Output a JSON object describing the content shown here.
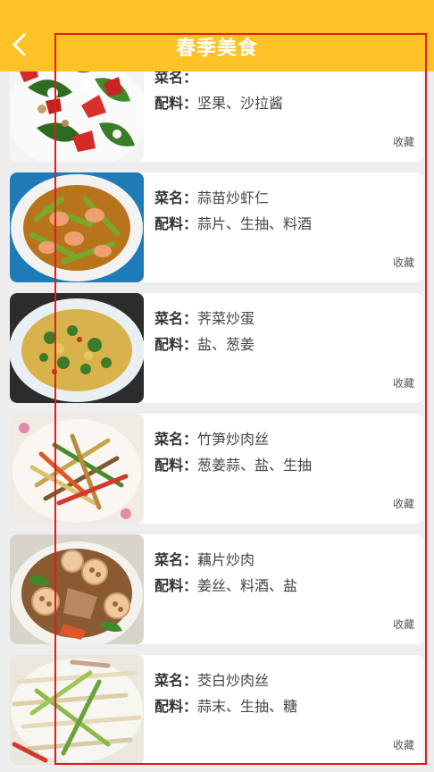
{
  "header": {
    "title": "春季美食",
    "back_icon": "chevron-left-icon",
    "background": "#fec126"
  },
  "labels": {
    "name_key": "菜名：",
    "ingredient_key": "配料：",
    "favorite": "收藏"
  },
  "items": [
    {
      "name": "",
      "ingredients": "坚果、沙拉酱",
      "image": "strawberry-spinach-salad"
    },
    {
      "name": "蒜苗炒虾仁",
      "ingredients": "蒜片、生抽、料酒",
      "image": "shrimp-garlic-sprouts"
    },
    {
      "name": "荠菜炒蛋",
      "ingredients": "盐、葱姜",
      "image": "shepherds-purse-egg"
    },
    {
      "name": "竹笋炒肉丝",
      "ingredients": "葱姜蒜、盐、生抽",
      "image": "bamboo-shoot-pork"
    },
    {
      "name": "藕片炒肉",
      "ingredients": "姜丝、料酒、盐",
      "image": "lotus-root-pork"
    },
    {
      "name": "茭白炒肉丝",
      "ingredients": "蒜末、生抽、糖",
      "image": "wild-rice-stem-pork"
    }
  ],
  "colors": {
    "highlight_frame": "#e21b1b"
  }
}
